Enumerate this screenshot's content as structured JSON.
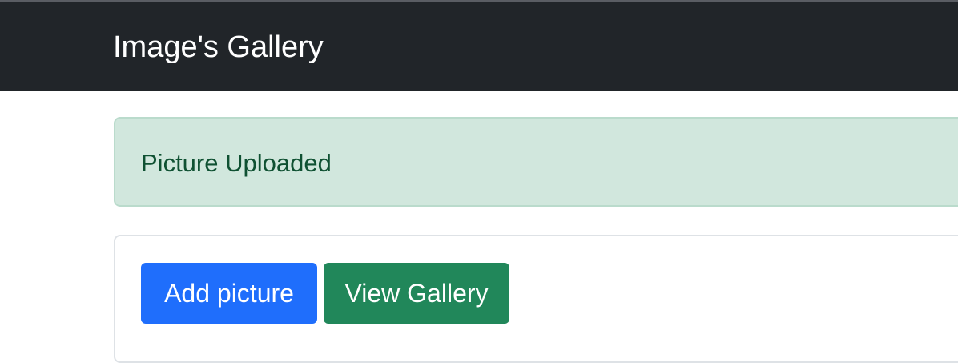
{
  "navbar": {
    "brand": "Image's Gallery",
    "background": "#212529"
  },
  "alert": {
    "message": "Picture Uploaded",
    "background": "#d1e7dd",
    "text_color": "#0f5132"
  },
  "actions": {
    "add_picture_label": "Add picture",
    "view_gallery_label": "View Gallery",
    "primary_color": "#1f6efc",
    "success_color": "#21875a"
  }
}
